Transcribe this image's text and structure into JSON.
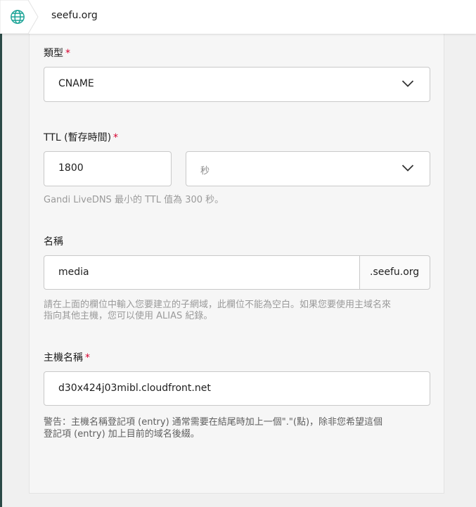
{
  "breadcrumb": {
    "domain": "seefu.org",
    "icon": "globe-icon"
  },
  "form": {
    "type": {
      "label": "類型",
      "required": "*",
      "value": "CNAME"
    },
    "ttl": {
      "label": "TTL (暫存時間)",
      "required": "*",
      "value": "1800",
      "unit_placeholder": "秒",
      "help": "Gandi LiveDNS 最小的 TTL 值為 300 秒。"
    },
    "name": {
      "label": "名稱",
      "value": "media",
      "suffix": ".seefu.org",
      "help_line1": "請在上面的欄位中輸入您要建立的子網域，此欄位不能為空白。如果您要使用主域名來",
      "help_line2": "指向其他主機，您可以使用 ALIAS 紀錄。"
    },
    "hostname": {
      "label": "主機名稱",
      "required": "*",
      "value": "d30x424j03mibl.cloudfront.net",
      "warning_line1": "警告：主機名稱登記項 (entry) 通常需要在結尾時加上一個\".\"(點)，除非您希望這個",
      "warning_line2": "登記項 (entry) 加上目前的域名後綴。"
    }
  },
  "colors": {
    "accent": "#1aa396",
    "required": "#d6002e"
  }
}
